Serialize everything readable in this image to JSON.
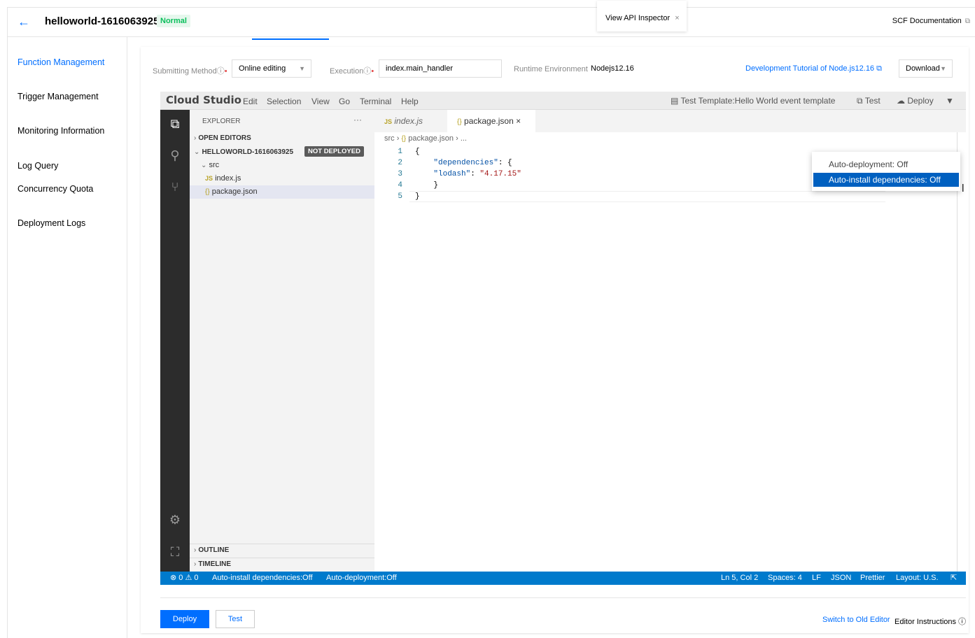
{
  "header": {
    "back_icon": "arrow-left-icon",
    "function_name": "helloworld-1616063925",
    "status_badge": "Normal",
    "api_inspector_tab": "View API Inspector",
    "api_inspector_close": "×",
    "doc_link": "SCF Documentation"
  },
  "sidebar": {
    "items": [
      {
        "label": "Function Management",
        "active": true
      },
      {
        "label": "Trigger Management"
      },
      {
        "label": "Monitoring Information"
      },
      {
        "label": "Log Query"
      },
      {
        "label": "Concurrency Quota"
      },
      {
        "label": "Deployment Logs"
      }
    ]
  },
  "form": {
    "submitting_method_label": "Submitting Method",
    "submitting_method_value": "Online editing",
    "execution_label": "Execution",
    "execution_value": "index.main_handler",
    "runtime_label": "Runtime Environment",
    "runtime_value": "Nodejs12.16",
    "tutorial_link": "Development Tutorial of Node.js12.16",
    "download_label": "Download"
  },
  "ide": {
    "logo": "Cloud Studio",
    "menu": [
      "Edit",
      "Selection",
      "View",
      "Go",
      "Terminal",
      "Help"
    ],
    "test_template": "Test Template:Hello World event template",
    "test_label": "Test",
    "deploy_label": "Deploy",
    "dropdown": [
      {
        "label": "Auto-deployment: Off"
      },
      {
        "label": "Auto-install dependencies: Off",
        "highlighted": true
      }
    ],
    "explorer": {
      "title": "EXPLORER",
      "more": "···",
      "open_editors": "OPEN EDITORS",
      "project": "HELLOWORLD-1616063925",
      "not_deployed": "NOT DEPLOYED",
      "folder": "src",
      "files": [
        "index.js",
        "package.json"
      ],
      "outline": "OUTLINE",
      "timeline": "TIMELINE"
    },
    "tabs": [
      {
        "label": "index.js",
        "icon": "JS"
      },
      {
        "label": "package.json",
        "icon": "{}",
        "active": true,
        "close": "×"
      }
    ],
    "breadcrumb": {
      "folder": "src",
      "file": "package.json",
      "more": "..."
    },
    "line_numbers": [
      "1",
      "2",
      "3",
      "4",
      "5"
    ],
    "code": {
      "l1": "{",
      "key_dependencies": "\"dependencies\"",
      "l2_rest": ": {",
      "key_lodash": "\"lodash\"",
      "colon": ": ",
      "val_lodash": "\"4.17.15\"",
      "l4": "    }",
      "l5": "}"
    },
    "status": {
      "errors": "⊗ 0 ⚠ 0",
      "auto_install": "Auto-install dependencies:Off",
      "auto_deploy": "Auto-deployment:Off",
      "position": "Ln 5, Col 2",
      "spaces": "Spaces: 4",
      "eol": "LF",
      "lang": "JSON",
      "formatter": "Prettier",
      "layout": "Layout: U.S."
    }
  },
  "footer": {
    "deploy_button": "Deploy",
    "test_button": "Test",
    "switch_link": "Switch to Old Editor",
    "instructions": "Editor Instructions"
  },
  "colors": {
    "accent": "#006eff",
    "status_green": "#0abf5b",
    "statusbar": "#007acc",
    "activity_bar": "#2c2c2c",
    "dropdown_highlight": "#0060c0"
  }
}
